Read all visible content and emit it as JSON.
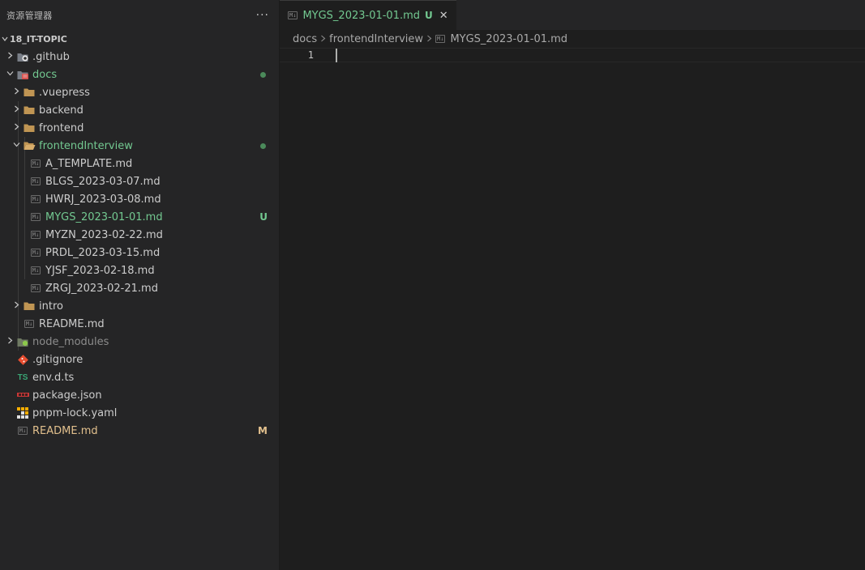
{
  "explorer": {
    "title": "资源管理器",
    "more": "···",
    "root": "18_IT-TOPIC"
  },
  "tree": [
    {
      "label": ".github",
      "icon": "github-folder-icon",
      "expanded": false
    },
    {
      "label": "docs",
      "icon": "docs-folder-icon",
      "expanded": true,
      "status": "dot",
      "color": "#73c991"
    },
    {
      "label": ".vuepress",
      "icon": "folder-icon",
      "expanded": false
    },
    {
      "label": "backend",
      "icon": "folder-icon",
      "expanded": false
    },
    {
      "label": "frontend",
      "icon": "folder-icon",
      "expanded": false
    },
    {
      "label": "frontendInterview",
      "icon": "folder-open-icon",
      "expanded": true,
      "status": "dot",
      "color": "#73c991"
    },
    {
      "label": "A_TEMPLATE.md",
      "icon": "markdown-icon"
    },
    {
      "label": "BLGS_2023-03-07.md",
      "icon": "markdown-icon"
    },
    {
      "label": "HWRJ_2023-03-08.md",
      "icon": "markdown-icon"
    },
    {
      "label": "MYGS_2023-01-01.md",
      "icon": "markdown-icon",
      "badge": "U",
      "color": "#73c991"
    },
    {
      "label": "MYZN_2023-02-22.md",
      "icon": "markdown-icon"
    },
    {
      "label": "PRDL_2023-03-15.md",
      "icon": "markdown-icon"
    },
    {
      "label": "YJSF_2023-02-18.md",
      "icon": "markdown-icon"
    },
    {
      "label": "ZRGJ_2023-02-21.md",
      "icon": "markdown-icon"
    },
    {
      "label": "intro",
      "icon": "folder-icon",
      "expanded": false
    },
    {
      "label": "README.md",
      "icon": "markdown-icon"
    },
    {
      "label": "node_modules",
      "icon": "node-folder-icon",
      "expanded": false,
      "color": "#8c8c8c"
    },
    {
      "label": ".gitignore",
      "icon": "git-icon"
    },
    {
      "label": "env.d.ts",
      "icon": "typescript-icon",
      "icon_text": "TS"
    },
    {
      "label": "package.json",
      "icon": "npm-icon"
    },
    {
      "label": "pnpm-lock.yaml",
      "icon": "pnpm-icon"
    },
    {
      "label": "README.md",
      "icon": "markdown-icon",
      "badge": "M",
      "color": "#e2c08d"
    }
  ],
  "editor": {
    "tab": {
      "label": "MYGS_2023-01-01.md",
      "badge": "U",
      "icon_text": "M↓",
      "close": "✕"
    },
    "breadcrumbs": [
      "docs",
      "frontendInterview",
      "MYGS_2023-01-01.md"
    ],
    "line_numbers": [
      "1"
    ]
  },
  "md_icon_text": "M↓"
}
